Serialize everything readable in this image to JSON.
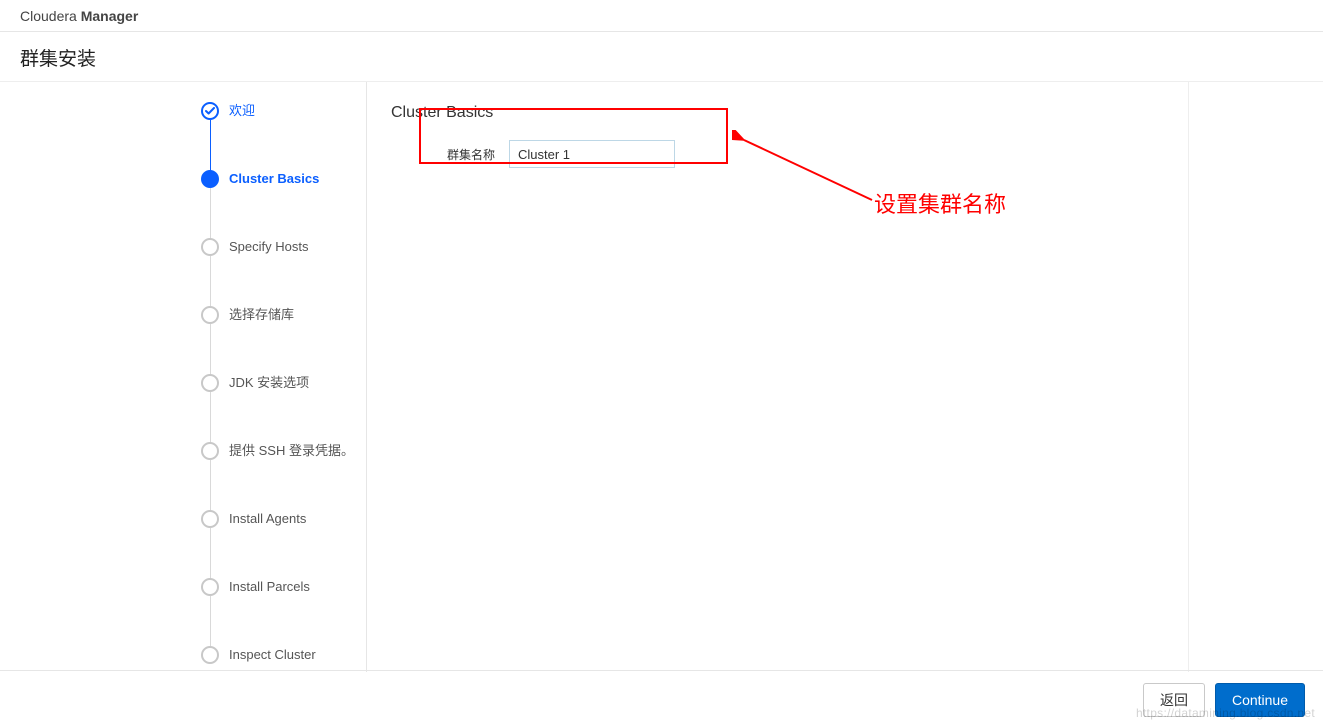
{
  "brand": {
    "light": "Cloudera ",
    "bold": "Manager"
  },
  "page_title": "群集安装",
  "steps": [
    {
      "label": "欢迎",
      "state": "done"
    },
    {
      "label": "Cluster Basics",
      "state": "current"
    },
    {
      "label": "Specify Hosts",
      "state": "todo"
    },
    {
      "label": "选择存储库",
      "state": "todo"
    },
    {
      "label": "JDK 安装选项",
      "state": "todo"
    },
    {
      "label": "提供 SSH 登录凭据。",
      "state": "todo"
    },
    {
      "label": "Install Agents",
      "state": "todo"
    },
    {
      "label": "Install Parcels",
      "state": "todo"
    },
    {
      "label": "Inspect Cluster",
      "state": "todo"
    }
  ],
  "section": {
    "title": "Cluster Basics",
    "cluster_name_label": "群集名称",
    "cluster_name_value": "Cluster 1"
  },
  "annotation": "设置集群名称",
  "footer": {
    "back": "返回",
    "continue": "Continue"
  },
  "watermark": "https://datamining.blog.csdn.net"
}
